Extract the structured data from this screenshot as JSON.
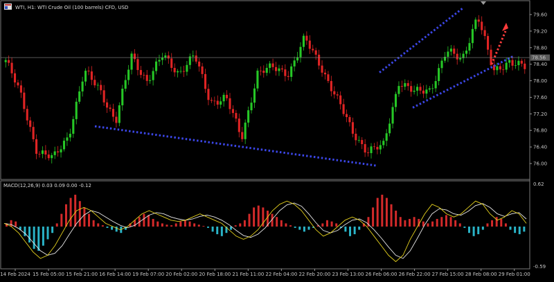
{
  "header": {
    "symbol": "WTI, H1:  WTI Crude Oil (100 barrels) CFD, USD",
    "icon": "chart-window-icon"
  },
  "price_panel": {
    "current_price_label": "78.56",
    "current_price": 78.56
  },
  "macd_panel": {
    "label": "MACD(12,26,9) 0.03 0.09 0.00 -0.12",
    "scale_top": "0.62",
    "scale_bottom": "-0.59"
  },
  "colors": {
    "background": "#000000",
    "bull_candle": "#26c726",
    "bear_candle": "#e02424",
    "trendline": "#3b46e6",
    "projection": "#ff3b3b",
    "macd_hist_pos": "#d42a2a",
    "macd_hist_neg": "#2ab4c8",
    "macd_line": "#e6d21e",
    "signal_line": "#e8e8e8",
    "price_line": "#8a8a8a",
    "price_label_bg": "#5a5a5a"
  },
  "chart_data": [
    {
      "type": "candlestick",
      "title": "WTI, H1:  WTI Crude Oil (100 barrels) CFD, USD",
      "xlabel": "",
      "ylabel": "",
      "y_ticks": [
        "79.60",
        "79.20",
        "78.80",
        "78.40",
        "78.00",
        "77.60",
        "77.20",
        "76.80",
        "76.40",
        "76.00"
      ],
      "ylim": [
        75.75,
        79.82
      ],
      "x_ticks": [
        "14 Feb 2024",
        "15 Feb 05:00",
        "15 Feb 21:00",
        "16 Feb 14:00",
        "19 Feb 07:00",
        "20 Feb 02:00",
        "20 Feb 18:00",
        "21 Feb 11:00",
        "22 Feb 04:00",
        "22 Feb 20:00",
        "23 Feb 13:00",
        "26 Feb 06:00",
        "26 Feb 22:00",
        "27 Feb 15:00",
        "28 Feb 08:00",
        "29 Feb 01:00"
      ],
      "close_path": [
        {
          "t": "14 Feb 2024",
          "v": 78.5
        },
        {
          "t": "14 Feb",
          "v": 77.6
        },
        {
          "t": "15 Feb",
          "v": 76.3
        },
        {
          "t": "15 Feb",
          "v": 76.1
        },
        {
          "t": "15 Feb 05:00",
          "v": 76.7
        },
        {
          "t": "15 Feb 05:00",
          "v": 78.2
        },
        {
          "t": "15 Feb 21:00",
          "v": 77.8
        },
        {
          "t": "16 Feb",
          "v": 77.0
        },
        {
          "t": "16 Feb 14:00",
          "v": 78.6
        },
        {
          "t": "16 Feb 14:00",
          "v": 78.0
        },
        {
          "t": "19 Feb 07:00",
          "v": 78.6
        },
        {
          "t": "19 Feb 07:00",
          "v": 78.2
        },
        {
          "t": "20 Feb 02:00",
          "v": 78.6
        },
        {
          "t": "20 Feb 02:00",
          "v": 77.5
        },
        {
          "t": "20 Feb 18:00",
          "v": 77.6
        },
        {
          "t": "20 Feb 18:00",
          "v": 76.6
        },
        {
          "t": "21 Feb 11:00",
          "v": 78.2
        },
        {
          "t": "21 Feb 11:00",
          "v": 78.3
        },
        {
          "t": "22 Feb 04:00",
          "v": 78.2
        },
        {
          "t": "22 Feb 04:00",
          "v": 79.0
        },
        {
          "t": "22 Feb 20:00",
          "v": 78.4
        },
        {
          "t": "22 Feb 20:00",
          "v": 77.6
        },
        {
          "t": "23 Feb 13:00",
          "v": 76.8
        },
        {
          "t": "26 Feb 06:00",
          "v": 76.3
        },
        {
          "t": "26 Feb 06:00",
          "v": 76.4
        },
        {
          "t": "26 Feb 22:00",
          "v": 78.0
        },
        {
          "t": "26 Feb 22:00",
          "v": 77.7
        },
        {
          "t": "27 Feb 15:00",
          "v": 77.8
        },
        {
          "t": "27 Feb 15:00",
          "v": 78.7
        },
        {
          "t": "28 Feb 08:00",
          "v": 78.5
        },
        {
          "t": "28 Feb 08:00",
          "v": 79.6
        },
        {
          "t": "28 Feb 08:00",
          "v": 78.2
        },
        {
          "t": "29 Feb 01:00",
          "v": 78.5
        },
        {
          "t": "29 Feb 01:00",
          "v": 78.3
        }
      ],
      "trendlines": [
        {
          "name": "lower-support",
          "from": [
            "16 Feb 14:00",
            76.9
          ],
          "to": [
            "26 Feb 06:00",
            75.95
          ]
        },
        {
          "name": "channel-upper",
          "from": [
            "26 Feb 06:00",
            78.2
          ],
          "to": [
            "28 Feb 08:00",
            79.75
          ]
        },
        {
          "name": "channel-lower",
          "from": [
            "27 Feb 15:00",
            77.35
          ],
          "to": [
            "29 Feb 01:00",
            78.6
          ]
        }
      ],
      "projection": {
        "from": [
          "29 Feb 01:00",
          78.4
        ],
        "to": [
          "29 Feb 01:00",
          79.3
        ]
      },
      "grid": false,
      "legend": "none"
    },
    {
      "type": "bar",
      "title": "MACD(12,26,9) 0.03 0.09 0.00 -0.12",
      "ylim": [
        -0.59,
        0.62
      ],
      "y_ticks": [
        "0.62",
        "-0.59"
      ],
      "histogram": [
        0.05,
        0.1,
        0.08,
        -0.05,
        -0.15,
        -0.25,
        -0.35,
        -0.38,
        -0.3,
        -0.2,
        -0.1,
        0.05,
        0.2,
        0.35,
        0.45,
        0.5,
        0.4,
        0.3,
        0.2,
        0.1,
        0.05,
        0.02,
        -0.02,
        -0.05,
        -0.08,
        -0.1,
        -0.05,
        0.05,
        0.1,
        0.15,
        0.2,
        0.18,
        0.12,
        0.08,
        0.05,
        0.03,
        0.02,
        0.05,
        0.08,
        0.1,
        0.08,
        0.05,
        0.03,
        0.01,
        -0.02,
        -0.08,
        -0.12,
        -0.15,
        -0.1,
        -0.05,
        0.02,
        0.05,
        0.1,
        0.2,
        0.3,
        0.33,
        0.3,
        0.25,
        0.2,
        0.15,
        0.1,
        0.05,
        0.02,
        -0.02,
        -0.05,
        -0.08,
        -0.05,
        -0.02,
        0.02,
        0.05,
        0.1,
        0.08,
        0.05,
        -0.02,
        -0.08,
        -0.15,
        -0.12,
        -0.05,
        0.05,
        0.15,
        0.3,
        0.45,
        0.5,
        0.45,
        0.35,
        0.25,
        0.15,
        0.1,
        0.12,
        0.15,
        0.12,
        0.08,
        0.05,
        0.08,
        0.12,
        0.15,
        0.18,
        0.15,
        0.1,
        0.05,
        -0.02,
        -0.1,
        -0.15,
        -0.12,
        -0.05,
        0.05,
        0.1,
        0.15,
        0.12,
        0.05,
        -0.05,
        -0.1,
        -0.12,
        -0.08
      ],
      "macd_line": [
        0.05,
        0.0,
        -0.1,
        -0.25,
        -0.4,
        -0.5,
        -0.45,
        -0.3,
        -0.1,
        0.1,
        0.25,
        0.3,
        0.25,
        0.15,
        0.05,
        0.0,
        -0.05,
        0.0,
        0.1,
        0.2,
        0.25,
        0.2,
        0.15,
        0.1,
        0.08,
        0.1,
        0.15,
        0.2,
        0.15,
        0.1,
        0.05,
        -0.05,
        -0.15,
        -0.2,
        -0.15,
        -0.05,
        0.1,
        0.25,
        0.35,
        0.4,
        0.35,
        0.25,
        0.1,
        -0.05,
        -0.15,
        -0.1,
        0.0,
        0.1,
        0.15,
        0.1,
        0.0,
        -0.15,
        -0.3,
        -0.45,
        -0.55,
        -0.45,
        -0.2,
        0.0,
        0.2,
        0.35,
        0.3,
        0.2,
        0.15,
        0.2,
        0.3,
        0.4,
        0.35,
        0.2,
        0.1,
        0.15,
        0.25,
        0.2,
        0.05
      ],
      "signal_line": [
        0.05,
        0.03,
        -0.03,
        -0.12,
        -0.25,
        -0.38,
        -0.45,
        -0.42,
        -0.3,
        -0.12,
        0.05,
        0.18,
        0.25,
        0.22,
        0.15,
        0.08,
        0.02,
        -0.02,
        0.02,
        0.1,
        0.18,
        0.22,
        0.2,
        0.15,
        0.12,
        0.1,
        0.12,
        0.16,
        0.18,
        0.15,
        0.1,
        0.03,
        -0.06,
        -0.14,
        -0.17,
        -0.12,
        -0.02,
        0.12,
        0.25,
        0.34,
        0.37,
        0.32,
        0.2,
        0.06,
        -0.06,
        -0.1,
        -0.06,
        0.03,
        0.1,
        0.12,
        0.06,
        -0.05,
        -0.18,
        -0.32,
        -0.45,
        -0.5,
        -0.38,
        -0.18,
        0.03,
        0.2,
        0.28,
        0.26,
        0.2,
        0.18,
        0.24,
        0.33,
        0.36,
        0.3,
        0.2,
        0.16,
        0.2,
        0.22,
        0.12
      ],
      "grid": false,
      "legend": "none"
    }
  ]
}
